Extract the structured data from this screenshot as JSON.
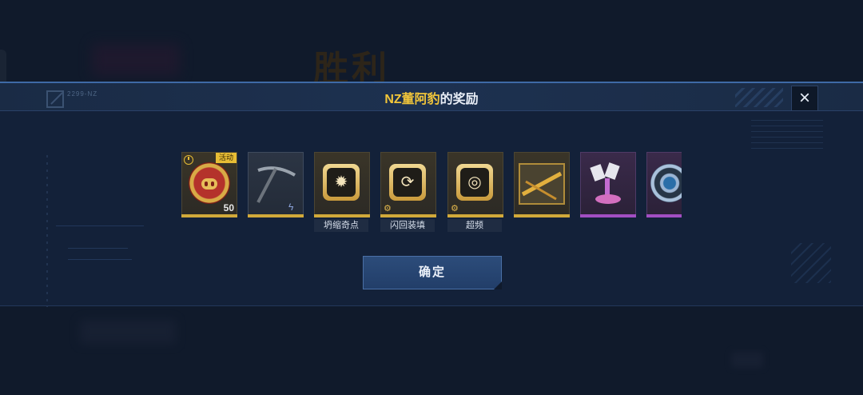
{
  "background": {
    "title": "胜利"
  },
  "dialog": {
    "title_name": "NZ董阿豹",
    "title_suffix": "的奖励",
    "header_code": "2299-NZ",
    "close_label": "×",
    "confirm_label": "确定"
  },
  "items": [
    {
      "tag": "活动",
      "quantity": "50",
      "icon": "pig-medal",
      "rarity": "gold"
    },
    {
      "icon": "pickaxe",
      "badge": "lightning",
      "rarity": "gold"
    },
    {
      "label": "坍缩奇点",
      "icon": "chip-singularity",
      "rarity": "gold"
    },
    {
      "label": "闪回装填",
      "icon": "chip-reload",
      "rarity": "gold"
    },
    {
      "label": "超频",
      "icon": "chip-overclock",
      "rarity": "gold"
    },
    {
      "icon": "weapon-crate",
      "rarity": "gold"
    },
    {
      "icon": "turret",
      "rarity": "purple"
    },
    {
      "icon": "ring-disc",
      "rarity": "purple"
    }
  ],
  "colors": {
    "accent": "#f2c63a",
    "gold_rarity": "#d1a93a",
    "purple_rarity": "#a24ec2",
    "panel": "#132139"
  }
}
